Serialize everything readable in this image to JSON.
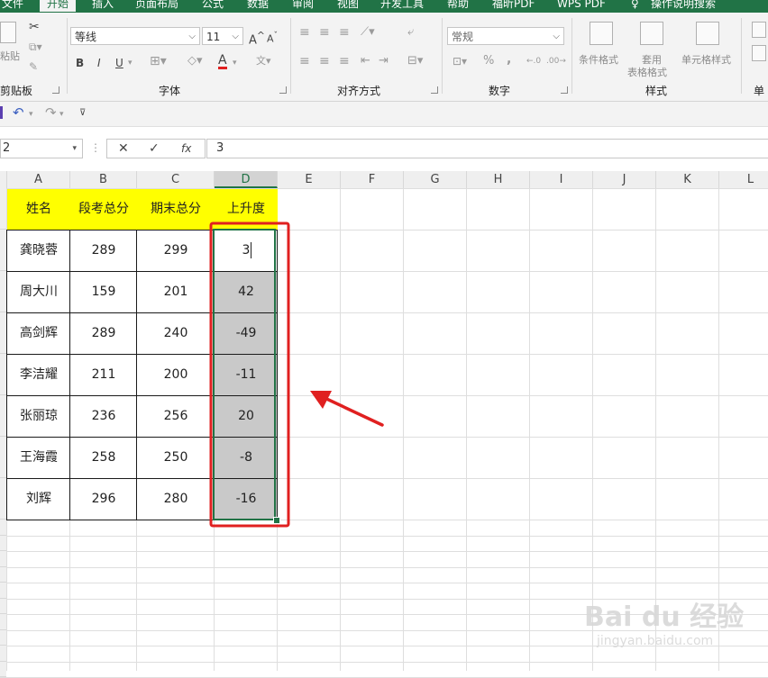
{
  "tabs": [
    {
      "label": "文件",
      "active": false
    },
    {
      "label": "开始",
      "active": true
    },
    {
      "label": "插入",
      "active": false
    },
    {
      "label": "页面布局",
      "active": false
    },
    {
      "label": "公式",
      "active": false
    },
    {
      "label": "数据",
      "active": false
    },
    {
      "label": "审阅",
      "active": false
    },
    {
      "label": "视图",
      "active": false
    },
    {
      "label": "开发工具",
      "active": false
    },
    {
      "label": "帮助",
      "active": false
    },
    {
      "label": "福昕PDF",
      "active": false
    },
    {
      "label": "WPS PDF",
      "active": false
    },
    {
      "label": "操作说明搜索",
      "active": false
    }
  ],
  "ribbon": {
    "clipboard": {
      "paste_label": "粘贴",
      "group_label": "剪贴板"
    },
    "font": {
      "font_name": "等线",
      "font_size": "11",
      "bold": "B",
      "italic": "I",
      "underline": "U",
      "grow": "A",
      "shrink": "A",
      "group_label": "字体"
    },
    "alignment": {
      "group_label": "对齐方式"
    },
    "number": {
      "format": "常规",
      "percent": "%",
      "comma": ",",
      "group_label": "数字"
    },
    "styles": {
      "conditional": "条件格式",
      "table_format_1": "套用",
      "table_format_2": "表格格式",
      "cell_styles": "单元格样式",
      "group_label": "样式"
    },
    "cells": {
      "label": "单"
    }
  },
  "formula_bar": {
    "name_box": "2",
    "formula": "3",
    "cancel": "✕",
    "enter": "✓",
    "fx": "fx"
  },
  "columns": [
    "A",
    "B",
    "C",
    "D",
    "E",
    "F",
    "G",
    "H",
    "I",
    "J",
    "K",
    "L"
  ],
  "selected_column": "D",
  "table": {
    "headers": [
      "姓名",
      "段考总分",
      "期末总分",
      "上升度"
    ],
    "rows": [
      [
        "龚晓蓉",
        "289",
        "299",
        "3"
      ],
      [
        "周大川",
        "159",
        "201",
        "42"
      ],
      [
        "高剑辉",
        "289",
        "240",
        "-49"
      ],
      [
        "李洁耀",
        "211",
        "200",
        "-11"
      ],
      [
        "张丽琼",
        "236",
        "256",
        "20"
      ],
      [
        "王海霞",
        "258",
        "250",
        "-8"
      ],
      [
        "刘辉",
        "296",
        "280",
        "-16"
      ]
    ]
  },
  "colors": {
    "excel_green": "#217346",
    "header_fill": "#ffff00",
    "highlight_box": "#e02020",
    "arrow": "#e02020",
    "selection_fill": "#c9c9c9"
  },
  "watermark": {
    "logo": "Bai du 经验",
    "url": "jingyan.baidu.com"
  }
}
